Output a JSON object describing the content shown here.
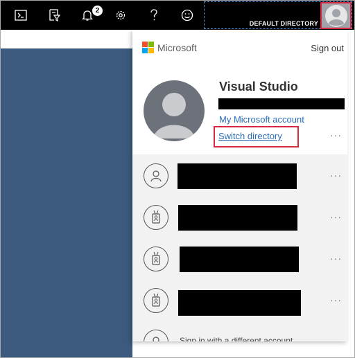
{
  "topbar": {
    "notification_count": "2",
    "icons": [
      "cloud-shell-icon",
      "directory-filter-icon",
      "notifications-icon",
      "settings-icon",
      "help-icon",
      "feedback-icon"
    ],
    "directory_label": "DEFAULT DIRECTORY"
  },
  "panel": {
    "brand": "Microsoft",
    "sign_out": "Sign out",
    "account_name": "Visual Studio",
    "my_account_link": "My Microsoft account",
    "switch_directory_link": "Switch directory",
    "more": "···",
    "sign_in_other": "Sign in with a different account"
  },
  "colors": {
    "topbar_bg": "#000000",
    "portal_bg": "#3b5a7d",
    "highlight_border": "#d6283f",
    "link": "#2b6cb8",
    "ms_red": "#f25022",
    "ms_green": "#7fba00",
    "ms_blue": "#00a4ef",
    "ms_yellow": "#ffb900"
  }
}
